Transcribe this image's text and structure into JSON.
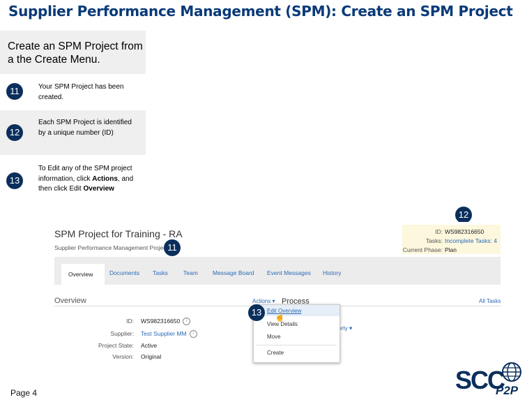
{
  "title": "Supplier Performance Management (SPM): Create an SPM Project",
  "intro": "Create an SPM Project from a the Create Menu.",
  "steps": [
    {
      "num": "11",
      "text": "Your SPM Project has been created."
    },
    {
      "num": "12",
      "text": "Each SPM Project is identified by a unique number (ID)"
    },
    {
      "num": "13",
      "text_parts": [
        "To Edit any of the SPM project information, click ",
        "Actions",
        ", and then click Edit ",
        "Overview"
      ]
    }
  ],
  "callouts": {
    "id_badge": "12",
    "title_badge": "11",
    "menu_badge": "13"
  },
  "screenshot": {
    "project_title": "SPM Project for Training - RA",
    "subtitle": "Supplier Performance Management Project",
    "info": {
      "id_label": "ID:",
      "id_value": "WS982316650",
      "tasks_label": "Tasks:",
      "tasks_value": "Incomplete Tasks: 4",
      "phase_label": "Current Phase:",
      "phase_value": "Plan"
    },
    "tabs": [
      "Overview",
      "Documents",
      "Tasks",
      "Team",
      "Message Board",
      "Event Messages",
      "History"
    ],
    "overview_heading": "Overview",
    "actions_label": "Actions ▾",
    "process_label": "Process",
    "all_tasks_label": "All Tasks",
    "actions_menu": [
      "Edit Overview",
      "View Details",
      "Move",
      "Create"
    ],
    "fields": [
      {
        "label": "ID:",
        "value": "WS982316650"
      },
      {
        "label": "Supplier:",
        "value": "Test Supplier MM"
      },
      {
        "label": "Project State:",
        "value": "Active"
      },
      {
        "label": "Version:",
        "value": "Original"
      }
    ],
    "partial_text": "erly ▾"
  },
  "page_label": "Page 4",
  "logo": {
    "text_main": "SCC",
    "text_sub": "P2P"
  },
  "colors": {
    "title": "#0a3a78",
    "badge": "#0b2f5c",
    "link": "#2a6bb7",
    "panel_bg": "#efefef",
    "info_bg": "#fcf7dd"
  }
}
